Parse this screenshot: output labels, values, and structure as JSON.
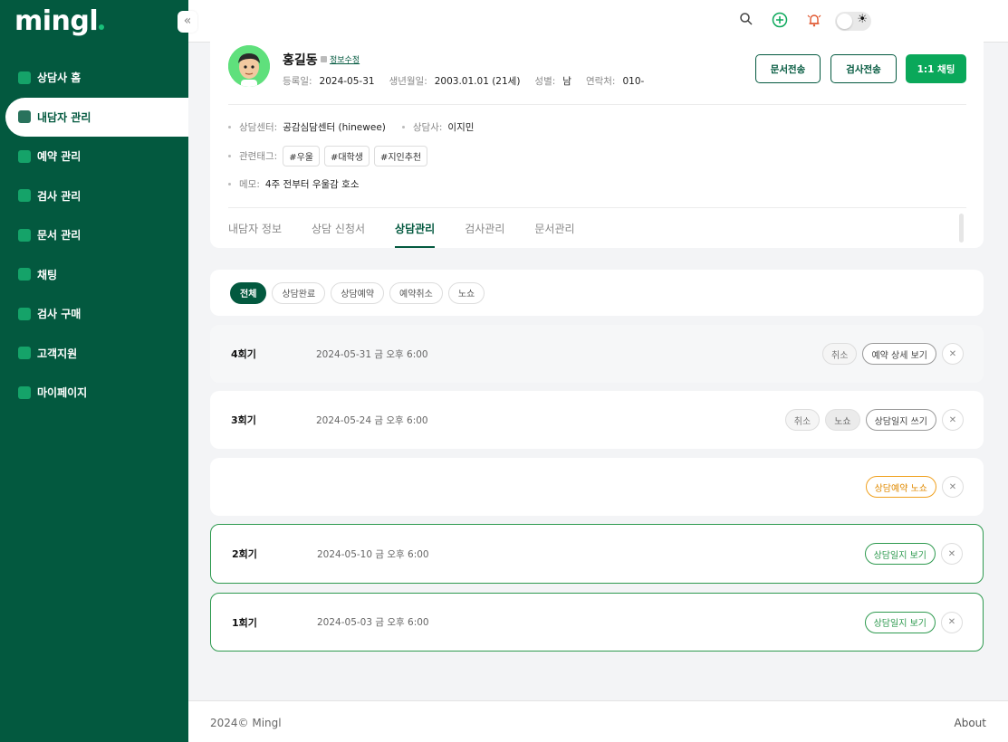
{
  "app": {
    "logo": "mingl"
  },
  "sidebar": {
    "items": [
      {
        "label": "상담사 홈",
        "icon": "home-icon"
      },
      {
        "label": "내담자 관리",
        "icon": "client-card-icon",
        "active": true
      },
      {
        "label": "예약 관리",
        "icon": "calendar-icon"
      },
      {
        "label": "검사 관리",
        "icon": "test-icon"
      },
      {
        "label": "문서 관리",
        "icon": "document-icon"
      },
      {
        "label": "채팅",
        "icon": "chat-icon"
      },
      {
        "label": "검사 구매",
        "icon": "purchase-icon"
      },
      {
        "label": "고객지원",
        "icon": "support-icon"
      },
      {
        "label": "마이페이지",
        "icon": "user-icon"
      }
    ]
  },
  "profile": {
    "name": "홍길동",
    "edit_label": "정보수정",
    "registered_label": "등록일:",
    "registered": "2024-05-31",
    "birth_label": "생년월일:",
    "birth": "2003.01.01 (21세)",
    "gender_label": "성별:",
    "gender": "남",
    "contact_label": "연락처:",
    "contact": "010-",
    "center_label": "상담센터:",
    "center": "공감심담센터 (hinewee)",
    "counselor_label": "상담사:",
    "counselor": "이지민",
    "tags_label": "관련태그:",
    "tags": [
      "#우울",
      "#대학생",
      "#지인추천"
    ],
    "memo_label": "메모:",
    "memo": "4주 전부터 우울감 호소",
    "buttons": {
      "send_doc": "문서전송",
      "send_test": "검사전송",
      "chat": "1:1 채팅"
    }
  },
  "tabs": [
    "내담자 정보",
    "상담 신청서",
    "상담관리",
    "검사관리",
    "문서관리"
  ],
  "filters": [
    "전체",
    "상담완료",
    "상담예약",
    "예약취소",
    "노쇼"
  ],
  "sessions": [
    {
      "round": "4회기",
      "date": "2024-05-31 금 오후 6:00",
      "actions": [
        "취소",
        "예약 상세 보기"
      ]
    },
    {
      "round": "3회기",
      "date": "2024-05-24 금 오후 6:00",
      "actions": [
        "취소",
        "노쇼",
        "상담일지 쓰기"
      ]
    },
    {
      "round": "",
      "date": "",
      "actions": [
        "상담예약 노쇼"
      ]
    },
    {
      "round": "2회기",
      "date": "2024-05-10 금 오후 6:00",
      "actions": [
        "상담일지 보기"
      ]
    },
    {
      "round": "1회기",
      "date": "2024-05-03 금 오후 6:00",
      "actions": [
        "상담일지 보기"
      ]
    }
  ],
  "footer": {
    "copyright": "2024© Mingl",
    "about": "About"
  },
  "colors": {
    "brand": "#03593f",
    "accent": "#0aa85a",
    "warning": "#f0a01e"
  }
}
